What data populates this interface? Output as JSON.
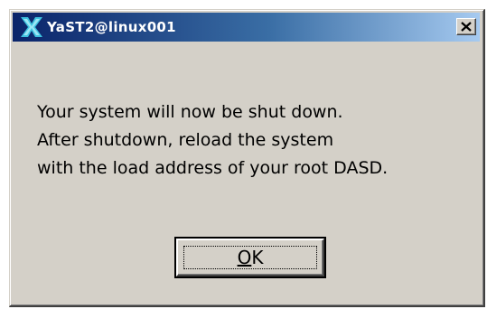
{
  "window": {
    "title": "YaST2@linux001",
    "icon": "yast-x-logo-icon",
    "close_glyph": "✕",
    "colors": {
      "titlebar_start": "#0a246a",
      "titlebar_end": "#a6caf0",
      "face": "#d4d0c8"
    }
  },
  "message": {
    "lines": [
      "Your system will now be shut down.",
      "After shutdown, reload the system",
      "with the load address of your root DASD."
    ]
  },
  "buttons": {
    "ok": {
      "mnemonic": "O",
      "rest": "K"
    }
  }
}
